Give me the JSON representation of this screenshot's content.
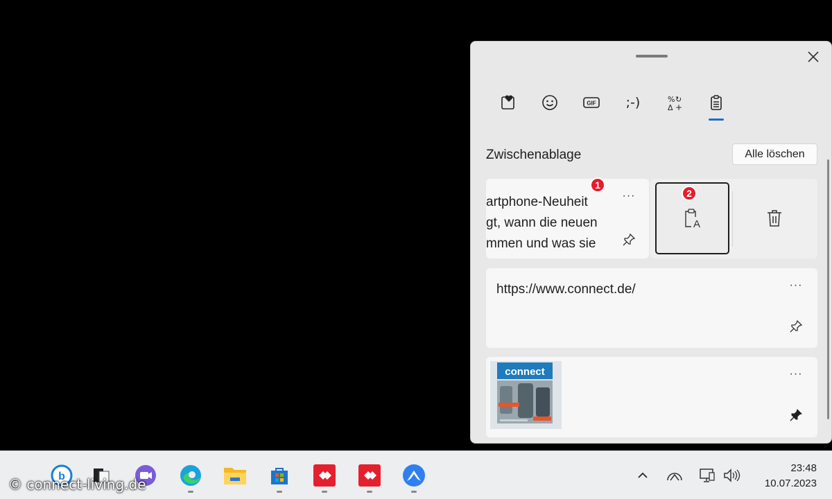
{
  "panel": {
    "tabs": [
      {
        "icon": "kaomoji-heart-icon"
      },
      {
        "icon": "emoji-icon"
      },
      {
        "icon": "gif-icon",
        "label": "GIF"
      },
      {
        "label": ";-)"
      },
      {
        "icon": "symbols-icon"
      },
      {
        "icon": "clipboard-icon",
        "active": true
      }
    ],
    "section_title": "Zwischenablage",
    "clear_all_label": "Alle löschen",
    "items": [
      {
        "lines": [
          "artphone-Neuheit",
          "gt, wann die neuen",
          "mmen und was sie"
        ],
        "more_label": "···",
        "badge_1": "1",
        "badge_2": "2"
      },
      {
        "url": "https://www.connect.de/",
        "more_label": "···"
      },
      {
        "thumb_title": "connect",
        "more_label": "···"
      }
    ],
    "accent_color": "#1a6fc4",
    "badge_color": "#e81b2a"
  },
  "taskbar": {
    "time": "23:48",
    "date": "10.07.2023",
    "watermark": "© connect-living.de"
  }
}
